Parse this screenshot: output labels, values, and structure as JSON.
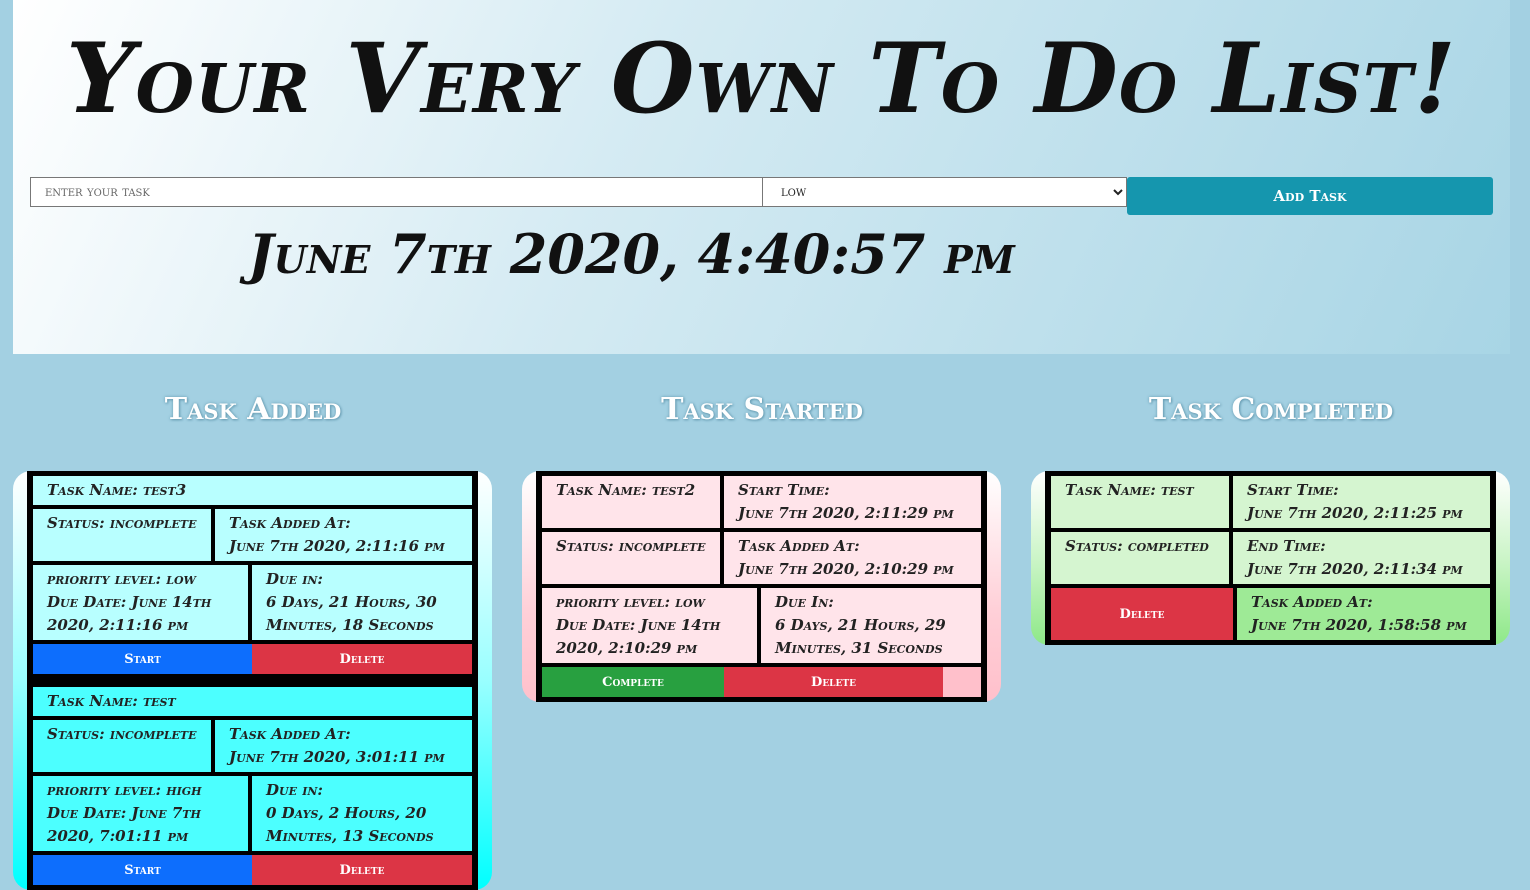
{
  "header": {
    "title": "Your Very Own To Do List!",
    "task_placeholder": "enter your task",
    "priority_value": "low",
    "priority_options": [
      "low"
    ],
    "add_button": "Add Task",
    "clock": "June 7th 2020, 4:40:57 pm"
  },
  "columns": {
    "added_title": "Task Added",
    "started_title": "Task Started",
    "completed_title": "Task Completed"
  },
  "added": [
    {
      "name": "Task Name: test3",
      "status": "Status: incomplete",
      "added_label": "Task Added At:",
      "added_at": "June 7th 2020, 2:11:16 pm",
      "priority": "priority level: low",
      "due_date": "Due Date: June 14th 2020, 2:11:16 pm",
      "due_label": "Due in:",
      "due_in": "6 Days, 21 Hours, 30 Minutes, 18 Seconds",
      "start_button": "Start",
      "delete_button": "Delete"
    },
    {
      "name": "Task Name: test",
      "status": "Status: incomplete",
      "added_label": "Task Added At:",
      "added_at": "June 7th 2020, 3:01:11 pm",
      "priority": "priority level: high",
      "due_date": "Due Date: June 7th 2020, 7:01:11 pm",
      "due_label": "Due in:",
      "due_in": "0 Days, 2 Hours, 20 Minutes, 13 Seconds",
      "start_button": "Start",
      "delete_button": "Delete"
    }
  ],
  "started": [
    {
      "name": "Task Name: test2",
      "start_label": "Start Time:",
      "start_time": "June 7th 2020, 2:11:29 pm",
      "status": "Status: incomplete",
      "added_label": "Task Added At:",
      "added_at": "June 7th 2020, 2:10:29 pm",
      "priority": "priority level: low",
      "due_date": "Due Date: June 14th 2020, 2:10:29 pm",
      "due_label": "Due In:",
      "due_in": "6 Days, 21 Hours, 29 Minutes, 31 Seconds",
      "complete_button": "Complete",
      "delete_button": "Delete"
    }
  ],
  "completed": [
    {
      "name": "Task Name: test",
      "start_label": "Start Time:",
      "start_time": "June 7th 2020, 2:11:25 pm",
      "status": "Status: completed",
      "end_label": "End Time:",
      "end_time": "June 7th 2020, 2:11:34 pm",
      "delete_button": "Delete",
      "added_label": "Task Added At:",
      "added_at": "June 7th 2020, 1:58:58 pm"
    }
  ]
}
